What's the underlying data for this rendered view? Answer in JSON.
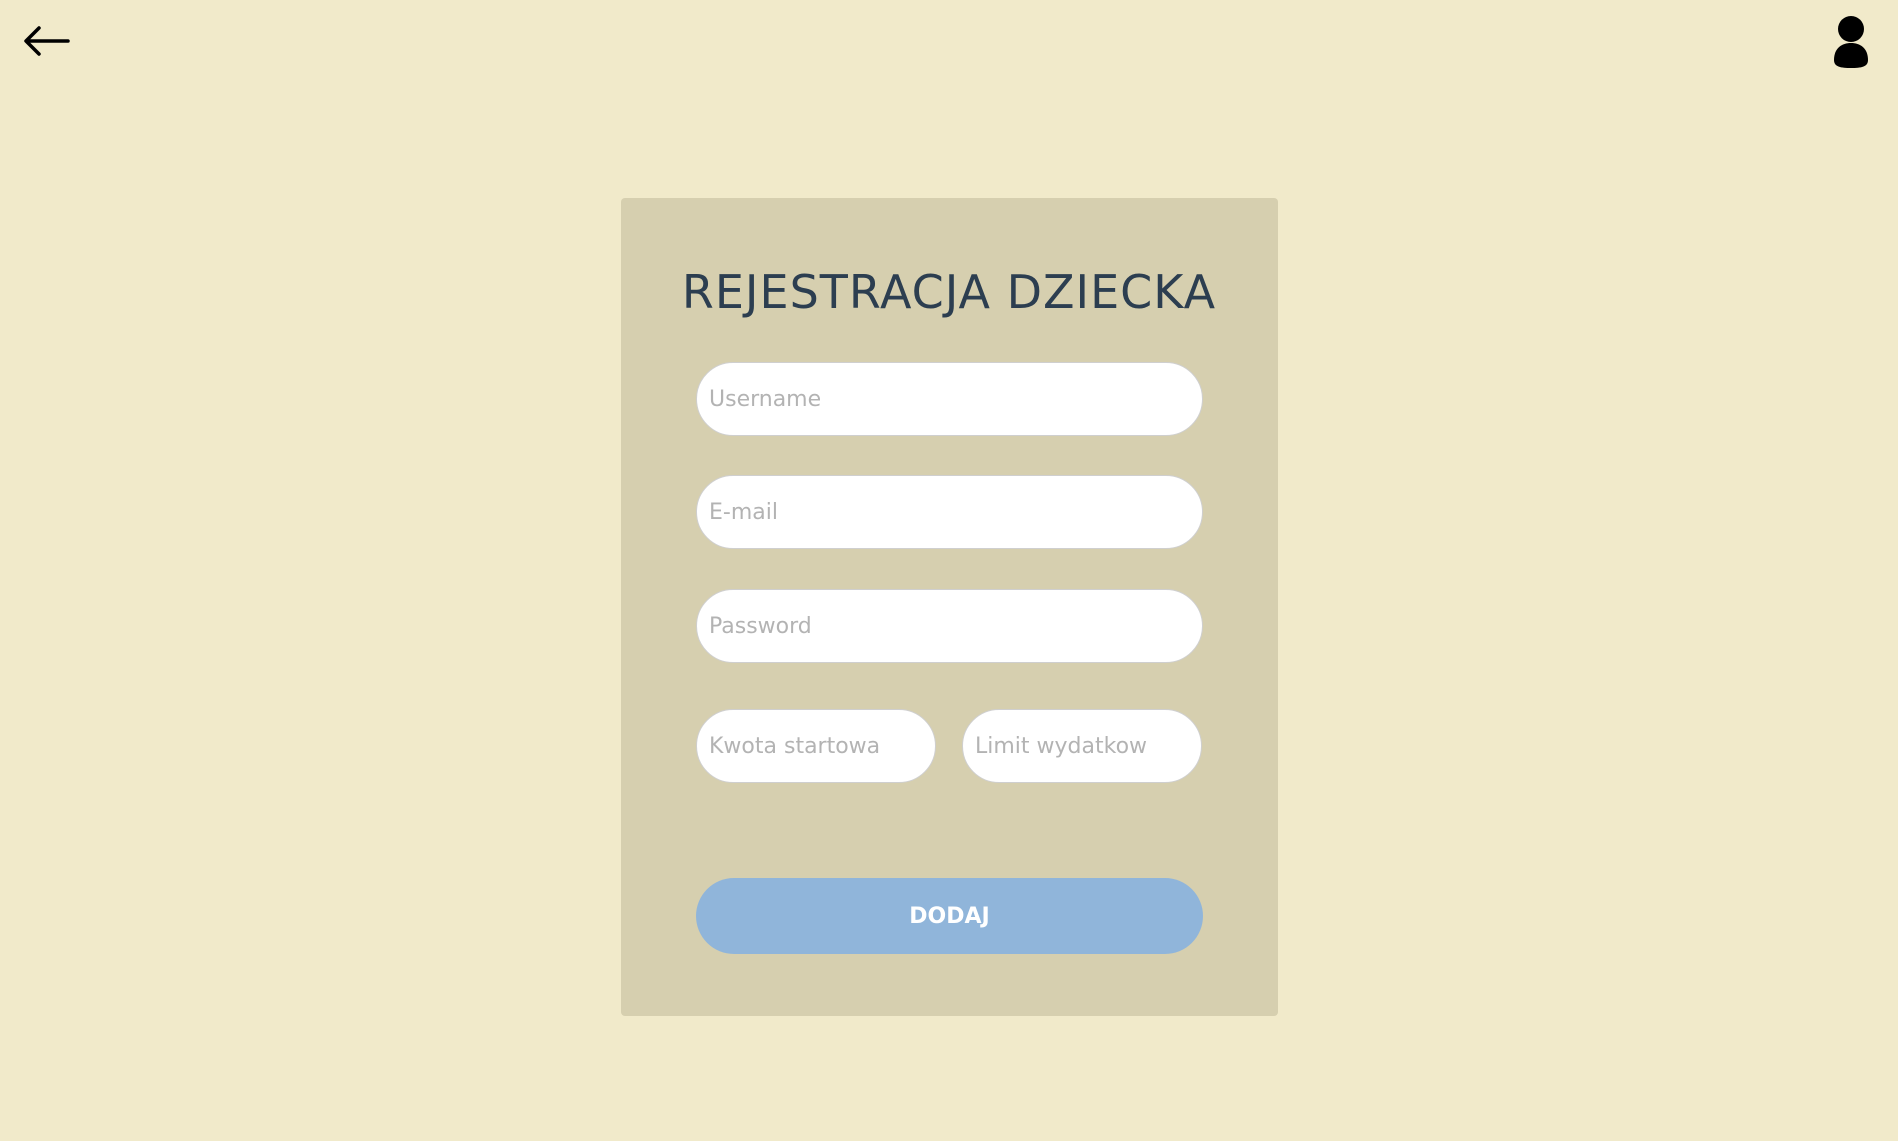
{
  "header": {
    "back_icon": "arrow-left-icon",
    "profile_icon": "user-icon"
  },
  "form": {
    "title": "REJESTRACJA DZIECKA",
    "username_placeholder": "Username",
    "email_placeholder": "E-mail",
    "password_placeholder": "Password",
    "start_amount_placeholder": "Kwota startowa",
    "spending_limit_placeholder": "Limit wydatkow",
    "submit_label": "DODAJ"
  },
  "colors": {
    "page_background": "#f1eaca",
    "card_background": "#d6cfaf",
    "title_text": "#2c3e50",
    "submit_button": "#90b5da"
  }
}
